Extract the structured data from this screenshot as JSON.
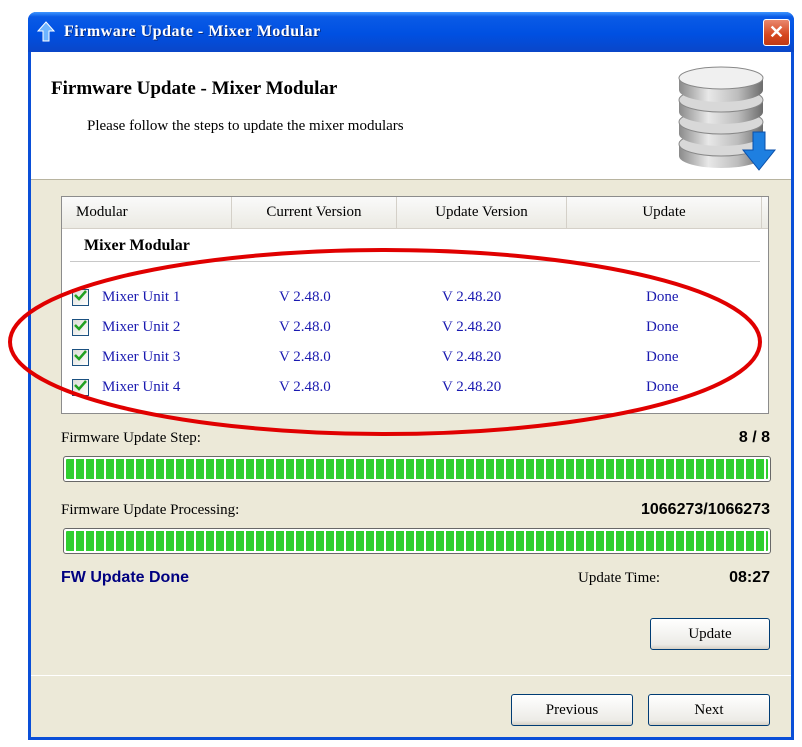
{
  "window": {
    "title": "Firmware Update - Mixer Modular",
    "close_icon": "close-icon"
  },
  "header": {
    "title": "Firmware Update - Mixer Modular",
    "subtitle": "Please follow the steps to update the mixer modulars"
  },
  "table": {
    "columns": [
      "Modular",
      "Current Version",
      "Update Version",
      "Update"
    ],
    "group": "Mixer Modular",
    "rows": [
      {
        "name": "Mixer Unit 1",
        "current": "V 2.48.0",
        "update": "V 2.48.20",
        "status": "Done",
        "checked": true
      },
      {
        "name": "Mixer Unit 2",
        "current": "V 2.48.0",
        "update": "V 2.48.20",
        "status": "Done",
        "checked": true
      },
      {
        "name": "Mixer Unit 3",
        "current": "V 2.48.0",
        "update": "V 2.48.20",
        "status": "Done",
        "checked": true
      },
      {
        "name": "Mixer Unit 4",
        "current": "V 2.48.0",
        "update": "V 2.48.20",
        "status": "Done",
        "checked": true
      }
    ]
  },
  "step": {
    "label": "Firmware Update Step:",
    "value": "8 / 8",
    "progress": 1.0
  },
  "processing": {
    "label": "Firmware Update Processing:",
    "value": "1066273/1066273",
    "progress": 1.0
  },
  "status": {
    "text": "FW Update Done",
    "time_label": "Update Time:",
    "time_value": "08:27"
  },
  "buttons": {
    "update": "Update",
    "previous": "Previous",
    "next": "Next"
  },
  "colors": {
    "title_bar": "#0050e2",
    "progress": "#2fcf2f",
    "row_text": "#1a1ab0",
    "annotation": "#e00000"
  }
}
